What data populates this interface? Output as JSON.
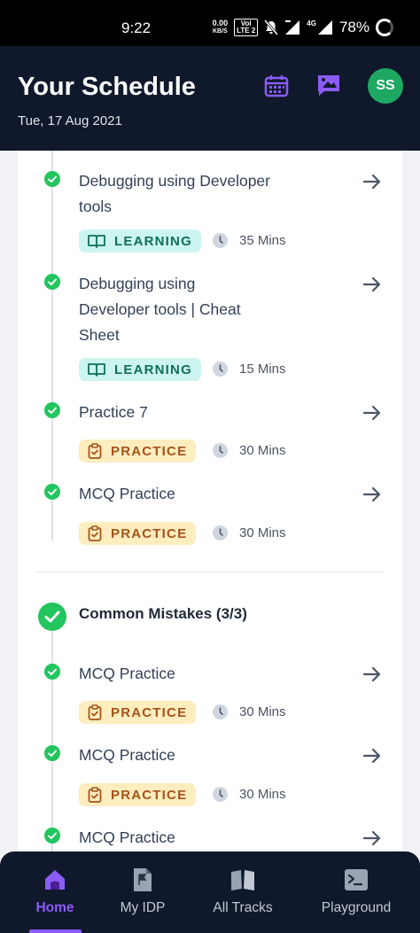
{
  "status_bar": {
    "time": "9:22",
    "net_speed_value": "0.00",
    "net_speed_unit": "KB/S",
    "volte_top": "VoI",
    "volte_bottom": "LTE 2",
    "network": "4G",
    "battery": "78%"
  },
  "header": {
    "title": "Your Schedule",
    "date": "Tue, 17 Aug 2021",
    "avatar_initials": "SS",
    "icon_color": "#8b5cf6"
  },
  "items_group1": [
    {
      "title": "Debugging using Developer tools",
      "tag": "LEARNING",
      "duration": "35 Mins"
    },
    {
      "title": "Debugging using Developer tools | Cheat Sheet",
      "tag": "LEARNING",
      "duration": "15 Mins"
    },
    {
      "title": "Practice 7",
      "tag": "PRACTICE",
      "duration": "30 Mins"
    },
    {
      "title": "MCQ Practice",
      "tag": "PRACTICE",
      "duration": "30 Mins"
    }
  ],
  "section": {
    "title": "Common Mistakes (3/3)"
  },
  "items_group2": [
    {
      "title": "MCQ Practice",
      "tag": "PRACTICE",
      "duration": "30 Mins"
    },
    {
      "title": "MCQ Practice",
      "tag": "PRACTICE",
      "duration": "30 Mins"
    },
    {
      "title": "MCQ Practice"
    }
  ],
  "bottom_nav": [
    {
      "label": "Home",
      "icon": "home-icon",
      "active": true
    },
    {
      "label": "My IDP",
      "icon": "document-flag-icon"
    },
    {
      "label": "All Tracks",
      "icon": "book-icon"
    },
    {
      "label": "Playground",
      "icon": "terminal-icon"
    }
  ],
  "colors": {
    "header_bg": "#0f192b",
    "check_green": "#22c55e",
    "accent_purple": "#8b5cf6",
    "learning_bg": "#cdf5ef",
    "practice_bg": "#fdedbf"
  }
}
